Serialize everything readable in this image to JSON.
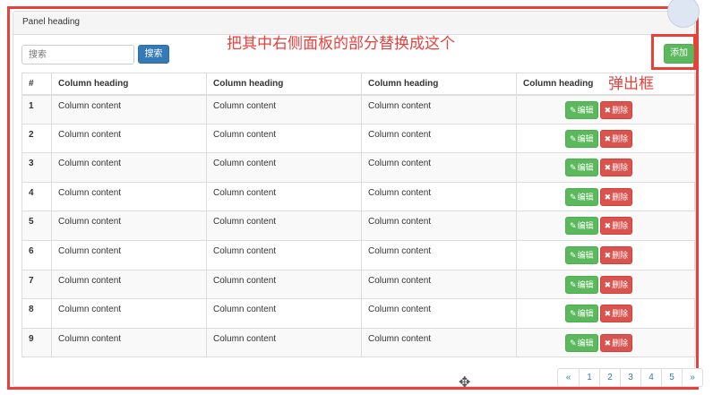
{
  "panel": {
    "heading": "Panel heading"
  },
  "search": {
    "placeholder": "搜索",
    "button_label": "搜索"
  },
  "add": {
    "button_label": "添加"
  },
  "annotations": {
    "main_note": "把其中右侧面板的部分替换成这个",
    "side_note": "弹出框"
  },
  "table": {
    "headers": [
      "#",
      "Column heading",
      "Column heading",
      "Column heading",
      "Column heading"
    ],
    "rows": [
      {
        "num": "1",
        "c1": "Column content",
        "c2": "Column content",
        "c3": "Column content"
      },
      {
        "num": "2",
        "c1": "Column content",
        "c2": "Column content",
        "c3": "Column content"
      },
      {
        "num": "3",
        "c1": "Column content",
        "c2": "Column content",
        "c3": "Column content"
      },
      {
        "num": "4",
        "c1": "Column content",
        "c2": "Column content",
        "c3": "Column content"
      },
      {
        "num": "5",
        "c1": "Column content",
        "c2": "Column content",
        "c3": "Column content"
      },
      {
        "num": "6",
        "c1": "Column content",
        "c2": "Column content",
        "c3": "Column content"
      },
      {
        "num": "7",
        "c1": "Column content",
        "c2": "Column content",
        "c3": "Column content"
      },
      {
        "num": "8",
        "c1": "Column content",
        "c2": "Column content",
        "c3": "Column content"
      },
      {
        "num": "9",
        "c1": "Column content",
        "c2": "Column content",
        "c3": "Column content"
      }
    ],
    "edit_label": "编辑",
    "delete_label": "删除",
    "edit_icon": "pencil-icon",
    "delete_icon": "remove-icon"
  },
  "pagination": {
    "items": [
      "«",
      "1",
      "2",
      "3",
      "4",
      "5",
      "»"
    ]
  },
  "colors": {
    "annotation_red": "#e8413c",
    "primary": "#337ab7",
    "success": "#5cb85c",
    "danger": "#d9534f"
  }
}
